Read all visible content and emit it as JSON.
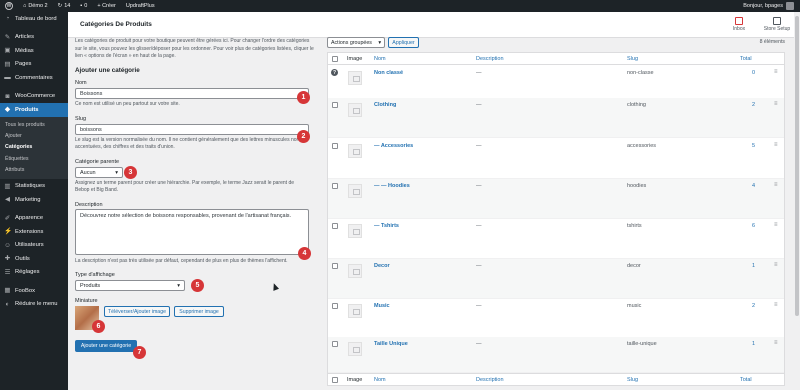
{
  "adminbar": {
    "site_name": "Démo 2",
    "updates_count": "14",
    "comments_count": "0",
    "new_label": "+ Créer",
    "updraft_label": "UpdraftPlus",
    "greeting": "Bonjour, bpages"
  },
  "sidebar": {
    "items": [
      {
        "label": "Tableau de bord",
        "icon": "dashboard-icon"
      },
      {
        "label": "Articles",
        "icon": "pin-icon"
      },
      {
        "label": "Médias",
        "icon": "media-icon"
      },
      {
        "label": "Pages",
        "icon": "page-icon"
      },
      {
        "label": "Commentaires",
        "icon": "comment-icon"
      },
      {
        "label": "WooCommerce",
        "icon": "woocommerce-icon"
      },
      {
        "label": "Produits",
        "icon": "product-icon"
      },
      {
        "label": "Statistiques",
        "icon": "chart-icon"
      },
      {
        "label": "Marketing",
        "icon": "megaphone-icon"
      },
      {
        "label": "Apparence",
        "icon": "brush-icon"
      },
      {
        "label": "Extensions",
        "icon": "plugin-icon"
      },
      {
        "label": "Utilisateurs",
        "icon": "users-icon"
      },
      {
        "label": "Outils",
        "icon": "wrench-icon"
      },
      {
        "label": "Réglages",
        "icon": "settings-icon"
      },
      {
        "label": "FooBox",
        "icon": "foobox-icon"
      },
      {
        "label": "Réduire le menu",
        "icon": "collapse-icon"
      }
    ],
    "submenu": [
      "Tous les produits",
      "Ajouter",
      "Catégories",
      "Étiquettes",
      "Attributs"
    ]
  },
  "header": {
    "title": "Catégories De Produits",
    "inbox_label": "Inbox",
    "setup_label": "Store Setup"
  },
  "form": {
    "intro": "Les catégories de produit pour votre boutique peuvent être gérées ici. Pour changer l'ordre des catégories sur le site, vous pouvez les glisser/déposer pour les ordonner. Pour voir plus de catégories listées, cliquer le lien « options de l'écran » en haut de la page.",
    "heading": "Ajouter une catégorie",
    "name_label": "Nom",
    "name_value": "Boissons",
    "name_help": "Ce nom est utilisé un peu partout sur votre site.",
    "slug_label": "Slug",
    "slug_value": "boissons",
    "slug_help": "Le slug est la version normalisée du nom. Il ne contient généralement que des lettres minuscules non accentuées, des chiffres et des traits d'union.",
    "parent_label": "Catégorie parente",
    "parent_value": "Aucun",
    "parent_help": "Assignez un terme parent pour créer une hiérarchie. Par exemple, le terme Jazz serait le parent de Bebop et Big Band.",
    "description_label": "Description",
    "description_value": "Découvrez notre sélection de boissons responsables, provenant de l'artisanat français.",
    "description_help": "La description n'est pas très utilisée par défaut, cependant de plus en plus de thèmes l'affichent.",
    "display_label": "Type d'affichage",
    "display_value": "Produits",
    "thumbnail_label": "Miniature",
    "upload_btn": "Téléverser/Ajouter image",
    "remove_btn": "Supprimer image",
    "submit_btn": "Ajouter une catégorie",
    "badges": [
      "1",
      "2",
      "3",
      "4",
      "5",
      "6",
      "7"
    ]
  },
  "table": {
    "bulk_value": "Actions groupées",
    "apply_label": "Appliquer",
    "count_label": "8 éléments",
    "headers": {
      "image": "Image",
      "name": "Nom",
      "description": "Description",
      "slug": "Slug",
      "total": "Total"
    },
    "rows": [
      {
        "name": "Non classé",
        "description": "—",
        "slug": "non-classe",
        "total": "0"
      },
      {
        "name": "Clothing",
        "description": "—",
        "slug": "clothing",
        "total": "2"
      },
      {
        "name": "— Accessories",
        "description": "—",
        "slug": "accessories",
        "total": "5"
      },
      {
        "name": "— — Hoodies",
        "description": "—",
        "slug": "hoodies",
        "total": "4"
      },
      {
        "name": "— Tshirts",
        "description": "—",
        "slug": "tshirts",
        "total": "6"
      },
      {
        "name": "Decor",
        "description": "—",
        "slug": "decor",
        "total": "1"
      },
      {
        "name": "Music",
        "description": "—",
        "slug": "music",
        "total": "2"
      },
      {
        "name": "Taille Unique",
        "description": "—",
        "slug": "taille-unique",
        "total": "1"
      }
    ]
  }
}
